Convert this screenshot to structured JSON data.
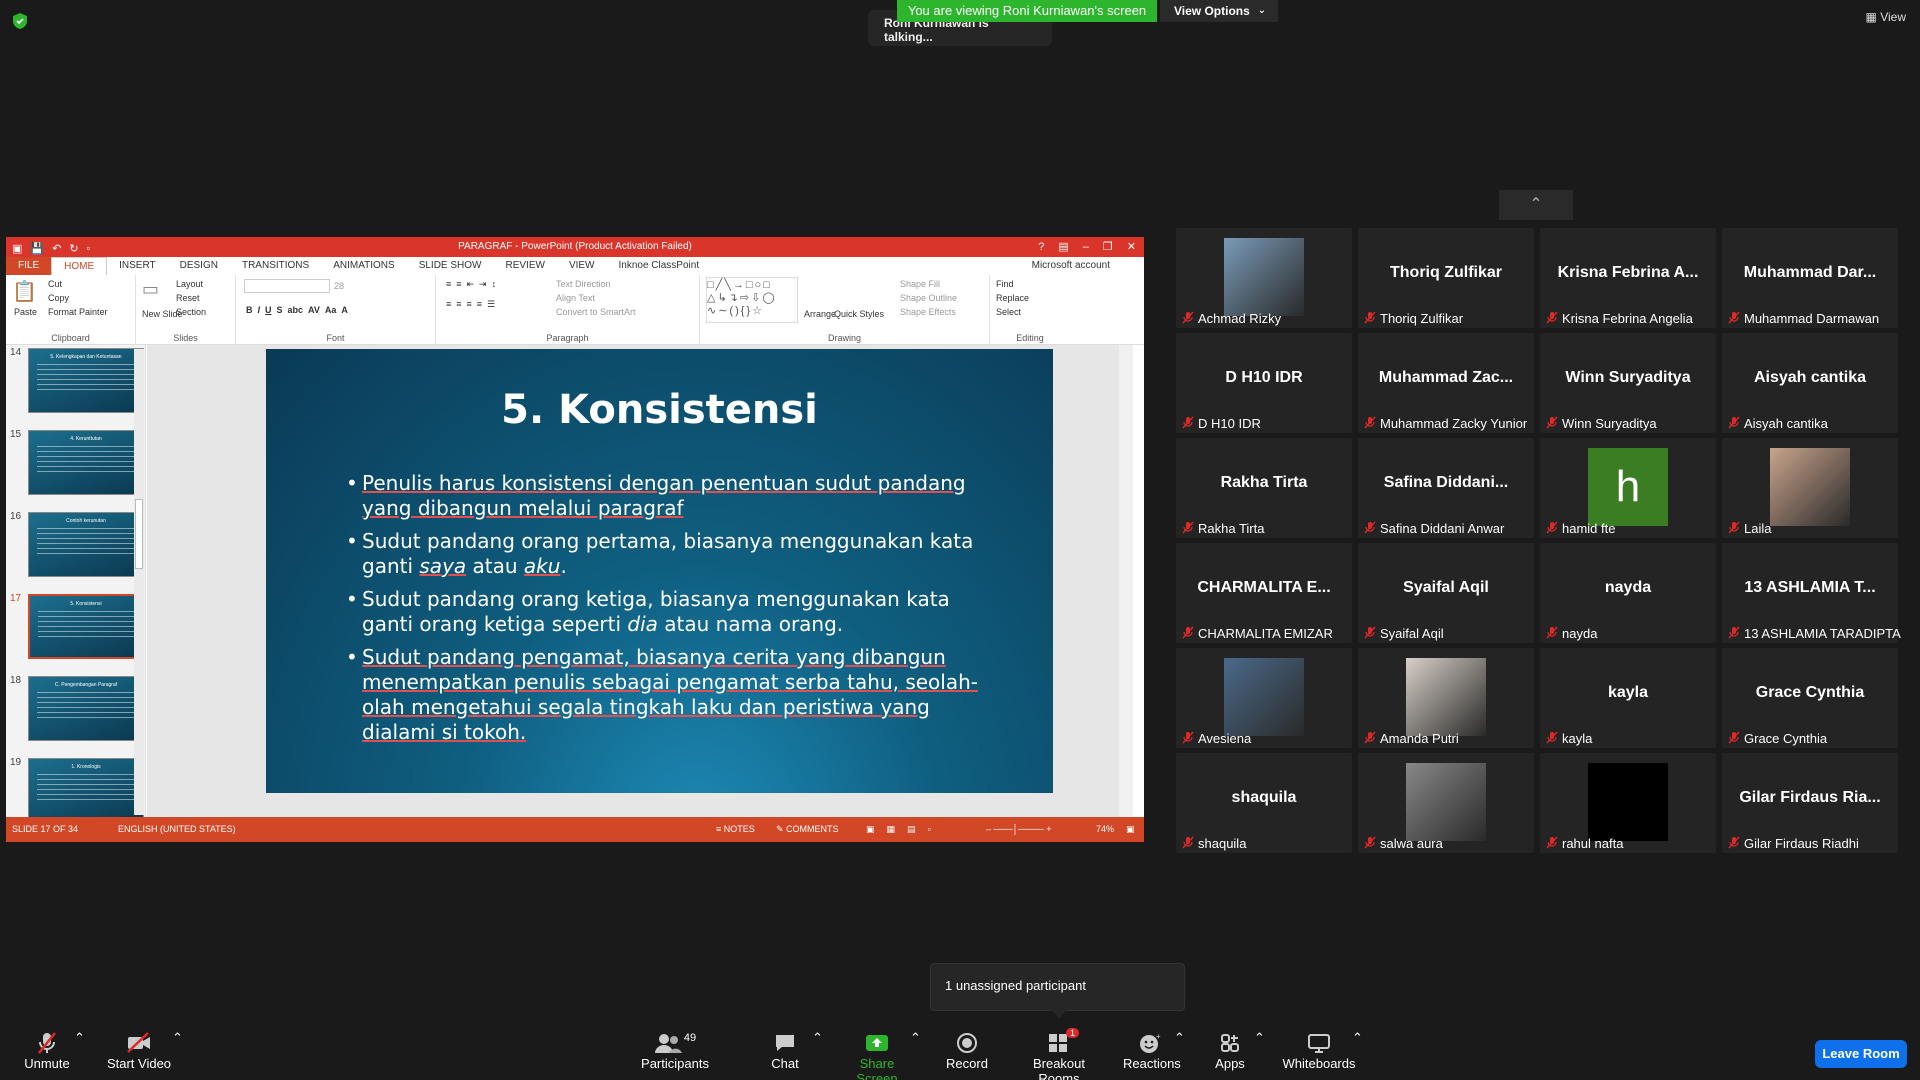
{
  "top": {
    "viewing_banner": "You are viewing Roni Kurniawan's screen",
    "view_options": "View Options",
    "talking": "Roni Kurniawan is talking...",
    "view_label": "View"
  },
  "ppt": {
    "window_title": "PARAGRAF - PowerPoint (Product Activation Failed)",
    "tabs": [
      "FILE",
      "HOME",
      "INSERT",
      "DESIGN",
      "TRANSITIONS",
      "ANIMATIONS",
      "SLIDE SHOW",
      "REVIEW",
      "VIEW",
      "Inknoe ClassPoint"
    ],
    "account": "Microsoft account",
    "ribbon": {
      "paste": "Paste",
      "cut": "Cut",
      "copy": "Copy",
      "format_painter": "Format Painter",
      "clipboard": "Clipboard",
      "new_slide": "New Slide",
      "layout": "Layout",
      "reset": "Reset",
      "section": "Section",
      "slides": "Slides",
      "font_size": "28",
      "font": "Font",
      "text_direction": "Text Direction",
      "align_text": "Align Text",
      "convert_smartart": "Convert to SmartArt",
      "paragraph": "Paragraph",
      "arrange": "Arrange",
      "quick_styles": "Quick Styles",
      "shape_fill": "Shape Fill",
      "shape_outline": "Shape Outline",
      "shape_effects": "Shape Effects",
      "drawing": "Drawing",
      "find": "Find",
      "replace": "Replace",
      "select": "Select",
      "editing": "Editing"
    },
    "thumbnails": [
      {
        "num": "14",
        "title": "5. Kelengkapan dan Ketuntasan"
      },
      {
        "num": "15",
        "title": "4. Kerunttutan"
      },
      {
        "num": "16",
        "title": "Contoh kerunutan"
      },
      {
        "num": "17",
        "title": "5. Konsistensi"
      },
      {
        "num": "18",
        "title": "C. Pengembangan Paragraf"
      },
      {
        "num": "19",
        "title": "1. Kronologis"
      }
    ],
    "slide": {
      "title": "5. Konsistensi",
      "bullet1": "Penulis harus konsistensi dengan penentuan sudut pandang yang dibangun melalui paragraf",
      "bullet2a": "Sudut pandang orang pertama, biasanya menggunakan kata ganti ",
      "bullet2b": "saya",
      "bullet2c": " atau ",
      "bullet2d": "aku",
      "bullet2e": ".",
      "bullet3a": "Sudut pandang orang ketiga, biasanya menggunakan kata ganti orang ketiga seperti ",
      "bullet3b": "dia",
      "bullet3c": " atau nama orang.",
      "bullet4": "Sudut pandang pengamat, biasanya cerita yang dibangun menempatkan penulis sebagai pengamat serba tahu, seolah-olah mengetahui segala tingkah laku dan peristiwa yang dialami si tokoh."
    },
    "status": {
      "slide_count": "SLIDE 17 OF 34",
      "language": "ENGLISH (UNITED STATES)",
      "notes": "NOTES",
      "comments": "COMMENTS",
      "zoom": "74%"
    }
  },
  "participants": [
    {
      "big": "",
      "name": "Achmad Rizky",
      "photo": true
    },
    {
      "big": "Thoriq Zulfikar",
      "name": "Thoriq Zulfikar"
    },
    {
      "big": "Krisna Febrina A...",
      "name": "Krisna Febrina Angelia"
    },
    {
      "big": "Muhammad Dar...",
      "name": "Muhammad Darmawan"
    },
    {
      "big": "D H10 IDR",
      "name": "D H10 IDR"
    },
    {
      "big": "Muhammad Zac...",
      "name": "Muhammad Zacky Yunior"
    },
    {
      "big": "Winn Suryaditya",
      "name": "Winn Suryaditya"
    },
    {
      "big": "Aisyah cantika",
      "name": "Aisyah cantika"
    },
    {
      "big": "Rakha Tirta",
      "name": "Rakha Tirta"
    },
    {
      "big": "Safina Diddani...",
      "name": "Safina Diddani Anwar"
    },
    {
      "big": "h",
      "name": "hamid fte",
      "avatar": true
    },
    {
      "big": "",
      "name": "Laila",
      "photo": true
    },
    {
      "big": "CHARMALITA E...",
      "name": "CHARMALITA EMIZAR"
    },
    {
      "big": "Syaifal Aqil",
      "name": "Syaifal Aqil"
    },
    {
      "big": "nayda",
      "name": "nayda"
    },
    {
      "big": "13 ASHLAMIA T...",
      "name": "13 ASHLAMIA TARADIPTA"
    },
    {
      "big": "",
      "name": "Avesiena",
      "photo": true
    },
    {
      "big": "",
      "name": "Amanda Putri",
      "photo": true
    },
    {
      "big": "kayla",
      "name": "kayla"
    },
    {
      "big": "Grace Cynthia",
      "name": "Grace Cynthia"
    },
    {
      "big": "shaquila",
      "name": "shaquila"
    },
    {
      "big": "",
      "name": "salwa aura",
      "photo": true
    },
    {
      "big": "",
      "name": "rahul nafta",
      "black": true
    },
    {
      "big": "Gilar Firdaus Ria...",
      "name": "Gilar Firdaus Riadhi"
    }
  ],
  "toast": "1 unassigned participant",
  "toolbar": {
    "unmute": "Unmute",
    "start_video": "Start Video",
    "participants": "Participants",
    "participants_count": "49",
    "chat": "Chat",
    "share_screen": "Share Screen",
    "record": "Record",
    "breakout_rooms": "Breakout Rooms",
    "breakout_badge": "1",
    "reactions": "Reactions",
    "apps": "Apps",
    "whiteboards": "Whiteboards",
    "leave_room": "Leave Room"
  },
  "colors": {
    "share_green": "#2eb52e",
    "leave_blue": "#0e71eb",
    "ppt_red": "#d24726",
    "mute_red": "#e02828"
  }
}
